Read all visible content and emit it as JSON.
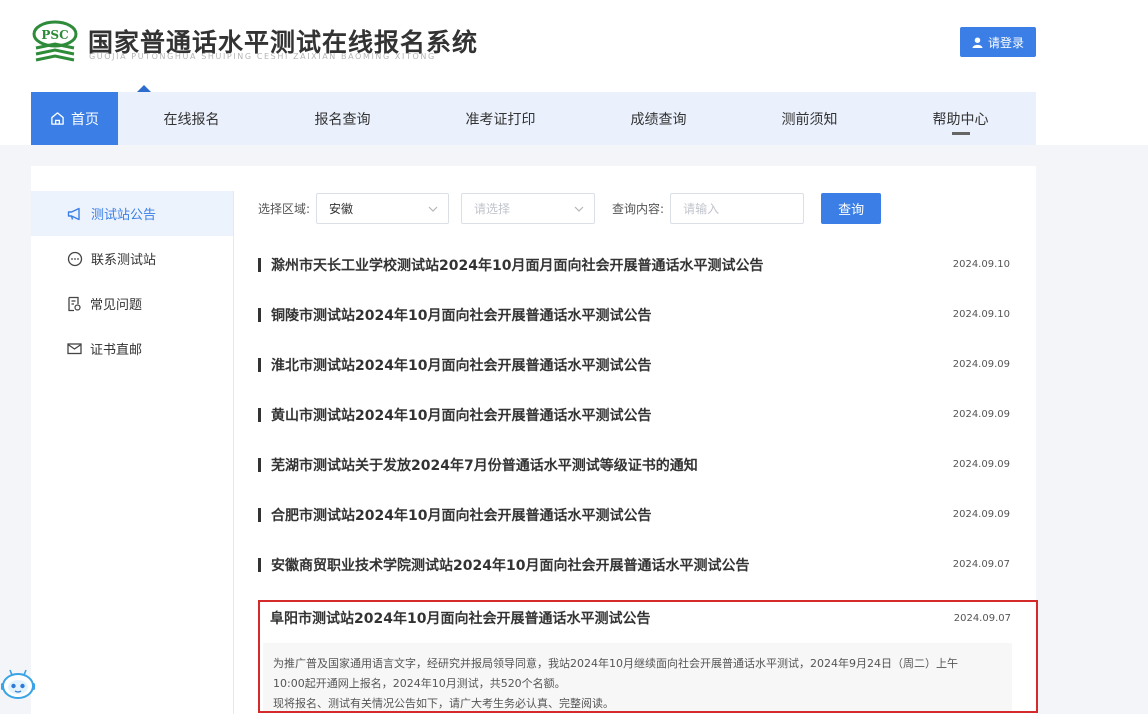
{
  "header": {
    "logo_text": "PSC",
    "title": "国家普通话水平测试在线报名系统",
    "subtitle": "GUOJIA PUTONGHUA SHUIPING CESHI ZAIXIAN BAOMING XITONG",
    "login_label": "请登录",
    "brand_color": "#3a7ee6"
  },
  "nav": {
    "items": [
      {
        "label": "首页",
        "icon": "home-icon",
        "active": true
      },
      {
        "label": "在线报名"
      },
      {
        "label": "报名查询"
      },
      {
        "label": "准考证打印"
      },
      {
        "label": "成绩查询"
      },
      {
        "label": "测前须知"
      },
      {
        "label": "帮助中心",
        "current_section": true
      }
    ]
  },
  "sidebar": {
    "items": [
      {
        "label": "测试站公告",
        "icon": "megaphone-icon",
        "active": true
      },
      {
        "label": "联系测试站",
        "icon": "chat-icon"
      },
      {
        "label": "常见问题",
        "icon": "document-icon"
      },
      {
        "label": "证书直邮",
        "icon": "mail-icon"
      }
    ]
  },
  "filter": {
    "region_label": "选择区域:",
    "province_value": "安徽",
    "city_placeholder": "请选择",
    "query_label": "查询内容:",
    "query_placeholder": "请输入",
    "query_button": "查询"
  },
  "notices": [
    {
      "title": "滁州市天长工业学校测试站2024年10月面月面向社会开展普通话水平测试公告",
      "date": "2024.09.10"
    },
    {
      "title": "铜陵市测试站2024年10月面向社会开展普通话水平测试公告",
      "date": "2024.09.10"
    },
    {
      "title": "淮北市测试站2024年10月面向社会开展普通话水平测试公告",
      "date": "2024.09.09"
    },
    {
      "title": "黄山市测试站2024年10月面向社会开展普通话水平测试公告",
      "date": "2024.09.09"
    },
    {
      "title": "芜湖市测试站关于发放2024年7月份普通话水平测试等级证书的通知",
      "date": "2024.09.09"
    },
    {
      "title": "合肥市测试站2024年10月面向社会开展普通话水平测试公告",
      "date": "2024.09.09"
    },
    {
      "title": "安徽商贸职业技术学院测试站2024年10月面向社会开展普通话水平测试公告",
      "date": "2024.09.07"
    }
  ],
  "expanded_notice": {
    "title": "阜阳市测试站2024年10月面向社会开展普通话水平测试公告",
    "date": "2024.09.07",
    "excerpt_line1": "为推广普及国家通用语言文字，经研究并报局领导同意，我站2024年10月继续面向社会开展普通话水平测试，2024年9月24日（周二）上午",
    "excerpt_line2": "10:00起开通网上报名，2024年10月测试，共520个名额。",
    "excerpt_line3": "现将报名、测试有关情况公告如下，请广大考生务必认真、完整阅读。",
    "highlight_color": "#d42a2a"
  },
  "assistant": {
    "icon": "robot-assistant-icon"
  }
}
